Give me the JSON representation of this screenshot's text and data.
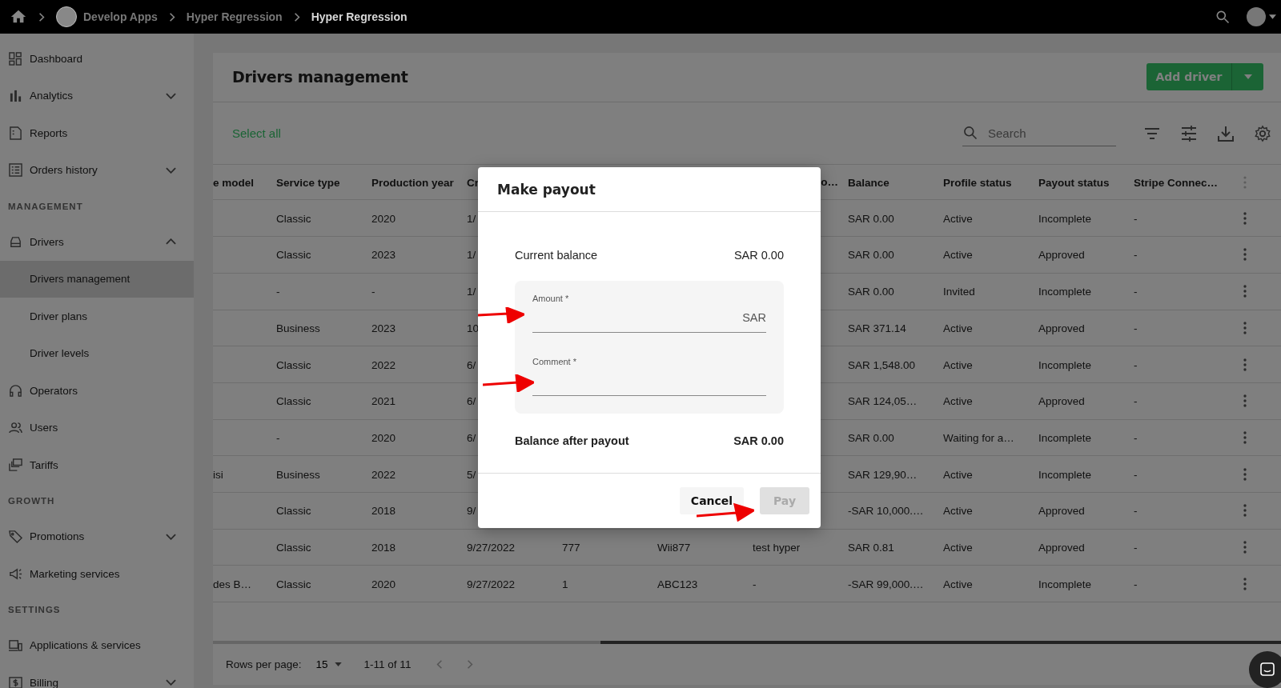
{
  "topbar": {
    "breadcrumbs": [
      {
        "label": "Develop Apps",
        "current": false,
        "avatar": true
      },
      {
        "label": "Hyper Regression",
        "current": false,
        "avatar": false
      },
      {
        "label": "Hyper Regression",
        "current": true,
        "avatar": false
      }
    ]
  },
  "sidebar": {
    "groups": [
      {
        "items": [
          {
            "label": "Dashboard",
            "selected": false
          },
          {
            "label": "Analytics",
            "selected": false,
            "expanded": false
          },
          {
            "label": "Reports",
            "selected": false
          },
          {
            "label": "Orders history",
            "selected": false,
            "expanded": false
          }
        ]
      },
      {
        "title": "MANAGEMENT",
        "items": [
          {
            "label": "Drivers",
            "selected": false,
            "expanded": true,
            "children": [
              {
                "label": "Drivers management",
                "selected": true
              },
              {
                "label": "Driver plans",
                "selected": false
              },
              {
                "label": "Driver levels",
                "selected": false
              }
            ]
          },
          {
            "label": "Operators",
            "selected": false
          },
          {
            "label": "Users",
            "selected": false
          },
          {
            "label": "Tariffs",
            "selected": false
          }
        ]
      },
      {
        "title": "GROWTH",
        "items": [
          {
            "label": "Promotions",
            "selected": false,
            "expanded": false
          },
          {
            "label": "Marketing services",
            "selected": false
          }
        ]
      },
      {
        "title": "SETTINGS",
        "items": [
          {
            "label": "Applications & services",
            "selected": false
          },
          {
            "label": "Billing",
            "selected": false,
            "expanded": false
          }
        ]
      }
    ]
  },
  "page": {
    "title": "Drivers management",
    "primary_button": "Add driver",
    "select_all": "Select all",
    "search": {
      "placeholder": "Search"
    }
  },
  "table": {
    "columns": [
      "e model",
      "Service type",
      "Production year",
      "Cr",
      null,
      null,
      "o…",
      "Balance",
      "Profile status",
      "Payout status",
      "Stripe Connec…"
    ],
    "rows": [
      {
        "cells": [
          null,
          "Classic",
          "2020",
          "1/",
          null,
          null,
          null,
          "SAR 0.00",
          "Active",
          "Incomplete",
          "-"
        ]
      },
      {
        "cells": [
          null,
          "Classic",
          "2023",
          "1/",
          null,
          null,
          null,
          "SAR 0.00",
          "Active",
          "Approved",
          "-"
        ]
      },
      {
        "cells": [
          null,
          "-",
          "-",
          "1/",
          null,
          null,
          null,
          "SAR 0.00",
          "Invited",
          "Incomplete",
          "-"
        ]
      },
      {
        "cells": [
          null,
          "Business",
          "2023",
          "10",
          null,
          null,
          null,
          "SAR 371.14",
          "Active",
          "Approved",
          "-"
        ]
      },
      {
        "cells": [
          null,
          "Classic",
          "2022",
          "6/",
          null,
          null,
          null,
          "SAR 1,548.00",
          "Active",
          "Incomplete",
          "-"
        ]
      },
      {
        "cells": [
          null,
          "Classic",
          "2021",
          "6/",
          null,
          null,
          null,
          "SAR 124,05…",
          "Active",
          "Approved",
          "-"
        ]
      },
      {
        "cells": [
          null,
          "-",
          "2020",
          "6/",
          null,
          null,
          null,
          "SAR 0.00",
          "Waiting for a…",
          "Incomplete",
          "-"
        ]
      },
      {
        "cells": [
          "isi",
          "Business",
          "2022",
          "5/",
          null,
          null,
          null,
          "SAR 129,90…",
          "Active",
          "Incomplete",
          "-"
        ]
      },
      {
        "cells": [
          null,
          "Classic",
          "2018",
          "9/",
          null,
          null,
          null,
          "-SAR 10,000.…",
          "Active",
          "Approved",
          "-"
        ]
      },
      {
        "cells": [
          null,
          "Classic",
          "2018",
          "9/27/2022",
          "777",
          "Wii877",
          "test hyper",
          "SAR 0.81",
          "Active",
          "Approved",
          "-"
        ]
      },
      {
        "cells": [
          "des B…",
          "Classic",
          "2020",
          "9/27/2022",
          "1",
          "ABC123",
          "-",
          "-SAR 99,000.…",
          "Active",
          "Incomplete",
          "-"
        ]
      }
    ]
  },
  "pagination": {
    "rows_per_page_label": "Rows per page:",
    "rows_per_page": "15",
    "range": "1-11 of 11"
  },
  "dialog": {
    "title": "Make payout",
    "current_balance": {
      "label": "Current balance",
      "value": "SAR 0.00"
    },
    "fields": [
      {
        "label": "Amount *",
        "suffix": "SAR"
      },
      {
        "label": "Comment *"
      }
    ],
    "balance_after": {
      "label": "Balance after payout",
      "value": "SAR 0.00"
    },
    "buttons": [
      {
        "label": "Cancel",
        "disabled": false,
        "kind": "text"
      },
      {
        "label": "Pay",
        "disabled": true,
        "kind": "filled"
      }
    ]
  }
}
